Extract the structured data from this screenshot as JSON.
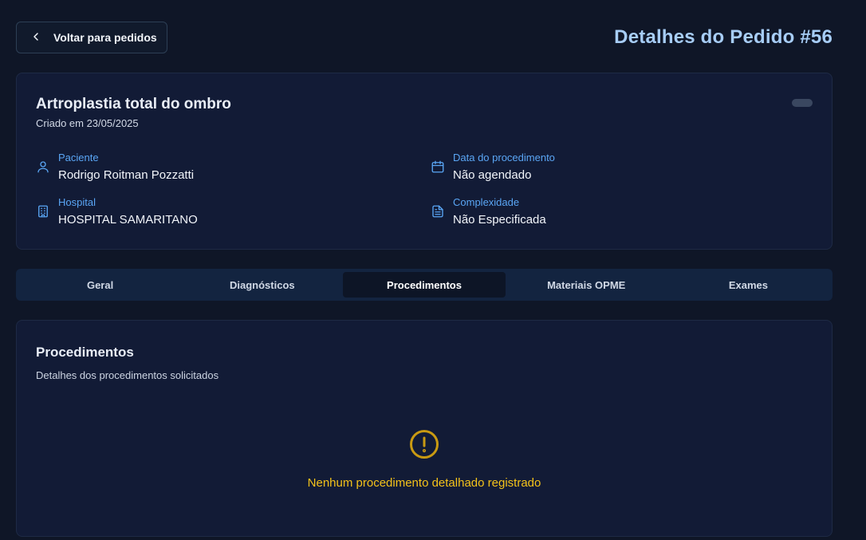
{
  "header": {
    "back_label": "Voltar para pedidos",
    "title": "Detalhes do Pedido #56"
  },
  "order": {
    "title": "Artroplastia total do ombro",
    "created": "Criado em 23/05/2025",
    "fields": {
      "patient": {
        "label": "Paciente",
        "value": "Rodrigo Roitman Pozzatti",
        "icon": "user-icon"
      },
      "hospital": {
        "label": "Hospital",
        "value": "HOSPITAL SAMARITANO",
        "icon": "building-icon"
      },
      "date": {
        "label": "Data do procedimento",
        "value": "Não agendado",
        "icon": "calendar-icon"
      },
      "complexity": {
        "label": "Complexidade",
        "value": "Não Especificada",
        "icon": "file-text-icon"
      }
    }
  },
  "tabs": [
    {
      "label": "Geral",
      "active": false
    },
    {
      "label": "Diagnósticos",
      "active": false
    },
    {
      "label": "Procedimentos",
      "active": true
    },
    {
      "label": "Materiais OPME",
      "active": false
    },
    {
      "label": "Exames",
      "active": false
    }
  ],
  "procedures": {
    "title": "Procedimentos",
    "subtitle": "Detalhes dos procedimentos solicitados",
    "empty_message": "Nenhum procedimento detalhado registrado",
    "empty_icon": "alert-circle-icon"
  },
  "colors": {
    "accent": "#a7cdf6",
    "label_blue": "#5aa6f5",
    "warning": "#f4c21a",
    "background": "#0f1627",
    "card": "#121b36"
  }
}
